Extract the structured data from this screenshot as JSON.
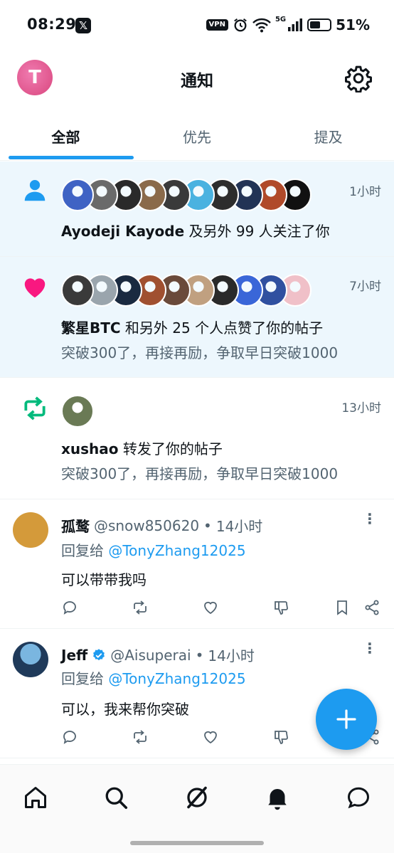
{
  "status_bar": {
    "time": "08:29",
    "x_badge": "𝕏",
    "vpn": "VPN",
    "network": "5G",
    "battery": "51%"
  },
  "header": {
    "title": "通知",
    "avatar_letter": "T"
  },
  "tabs": [
    {
      "label": "全部",
      "active": true
    },
    {
      "label": "优先",
      "active": false
    },
    {
      "label": "提及",
      "active": false
    }
  ],
  "notifications": [
    {
      "type": "follow",
      "time": "1小时",
      "actor": "Ayodeji Kayode",
      "text": " 及另外 99 人关注了你",
      "sub": "",
      "avatar_colors": [
        "#3f63c4",
        "#6a6a6a",
        "#2a2a2a",
        "#8a6a4a",
        "#3a3a3a",
        "#4ab2e0",
        "#2d2d2d",
        "#223355",
        "#b04a2a",
        "#111111"
      ]
    },
    {
      "type": "like",
      "time": "7小时",
      "actor": "繁星BTC",
      "text": " 和另外 25 个人点赞了你的帖子",
      "sub": "突破300了，再接再励，争取早日突破1000",
      "avatar_colors": [
        "#3a3a3a",
        "#9aa5ad",
        "#1a2a40",
        "#a05030",
        "#6a4a3a",
        "#c0a080",
        "#2a2a2a",
        "#3a66d8",
        "#3050a0",
        "#f0c0c8"
      ]
    },
    {
      "type": "repost",
      "time": "13小时",
      "actor": "xushao",
      "text": " 转发了你的帖子",
      "sub": "突破300了，再接再励，争取早日突破1000",
      "avatar_colors": [
        "#6a7a55"
      ]
    }
  ],
  "posts": [
    {
      "name": "孤鹜",
      "handle": "@snow850620",
      "time": "14小时",
      "verified": false,
      "reply_prefix": "回复给 ",
      "reply_to": "@TonyZhang12025",
      "body": "可以带带我吗",
      "avatar_color": "#d49a3a"
    },
    {
      "name": "Jeff",
      "handle": "@Aisuperai",
      "time": "14小时",
      "verified": true,
      "reply_prefix": "回复给 ",
      "reply_to": "@TonyZhang12025",
      "body": "可以，我来帮你突破",
      "avatar_color": "#1f3a5a"
    }
  ],
  "colors": {
    "accent": "#1d9bf0",
    "like": "#f91880",
    "repost": "#00ba7c",
    "unread_bg": "#edf7fd"
  }
}
